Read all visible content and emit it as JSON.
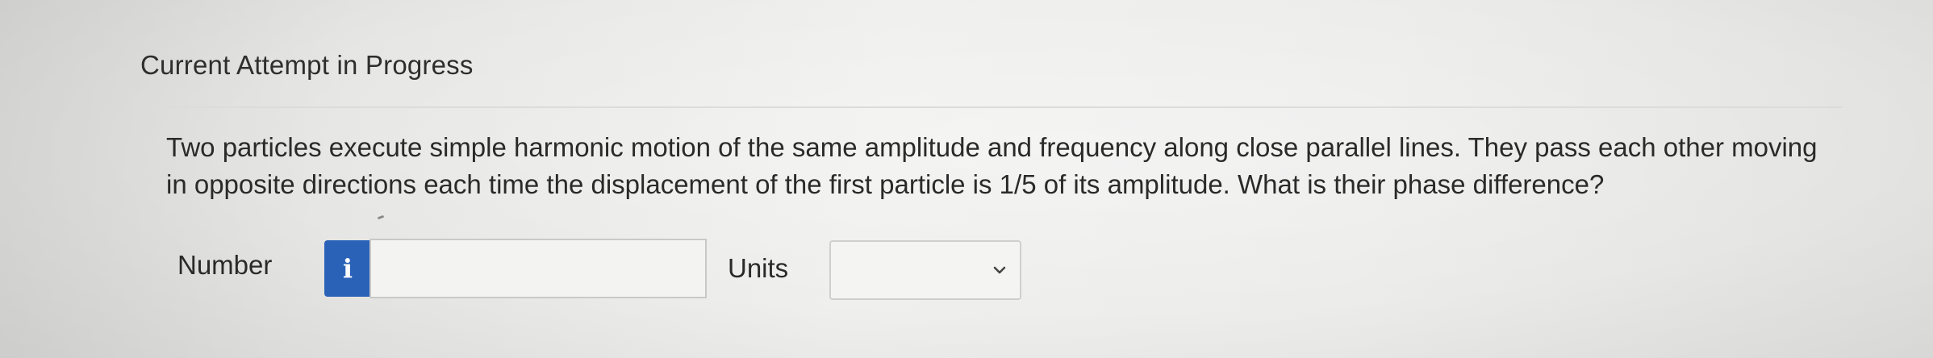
{
  "header": {
    "title": "Current Attempt in Progress"
  },
  "question": {
    "text": "Two particles execute simple harmonic motion of the same amplitude and frequency along close parallel lines. They pass each other moving in opposite directions each time the displacement of the first particle is 1/5 of its amplitude. What is their phase difference?"
  },
  "answer": {
    "number_label": "Number",
    "info_icon_glyph": "i",
    "number_value": "",
    "units_label": "Units",
    "units_selected": ""
  },
  "colors": {
    "info_button": "#2a62b8",
    "text": "#2a2a2a"
  },
  "icons": {
    "info": "info-icon",
    "dropdown": "chevron-down-icon"
  }
}
